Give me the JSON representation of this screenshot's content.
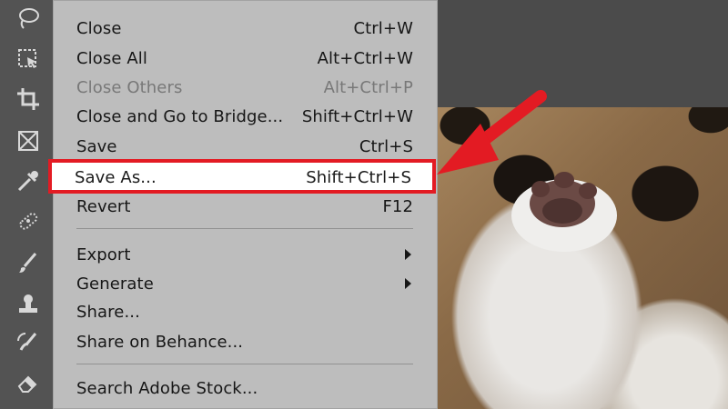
{
  "tools": [
    {
      "icon": "lasso-icon"
    },
    {
      "icon": "object-selection-icon"
    },
    {
      "icon": "crop-icon"
    },
    {
      "icon": "frame-icon"
    },
    {
      "icon": "eyedropper-icon"
    },
    {
      "icon": "healing-brush-icon"
    },
    {
      "icon": "brush-icon"
    },
    {
      "icon": "clone-stamp-icon"
    },
    {
      "icon": "history-brush-icon"
    },
    {
      "icon": "eraser-icon"
    }
  ],
  "menu": {
    "items": [
      {
        "label": "Close",
        "shortcut": "Ctrl+W"
      },
      {
        "label": "Close All",
        "shortcut": "Alt+Ctrl+W"
      },
      {
        "label": "Close Others",
        "shortcut": "Alt+Ctrl+P"
      },
      {
        "label": "Close and Go to Bridge...",
        "shortcut": "Shift+Ctrl+W"
      },
      {
        "label": "Save",
        "shortcut": "Ctrl+S"
      },
      {
        "label": "Save As...",
        "shortcut": "Shift+Ctrl+S"
      },
      {
        "label": "Revert",
        "shortcut": "F12"
      },
      {
        "label": "Export",
        "shortcut": ""
      },
      {
        "label": "Generate",
        "shortcut": ""
      },
      {
        "label": "Share...",
        "shortcut": ""
      },
      {
        "label": "Share on Behance...",
        "shortcut": ""
      },
      {
        "label": "Search Adobe Stock...",
        "shortcut": ""
      }
    ]
  },
  "colors": {
    "highlight_border": "#e31b23",
    "arrow": "#e31b23"
  }
}
